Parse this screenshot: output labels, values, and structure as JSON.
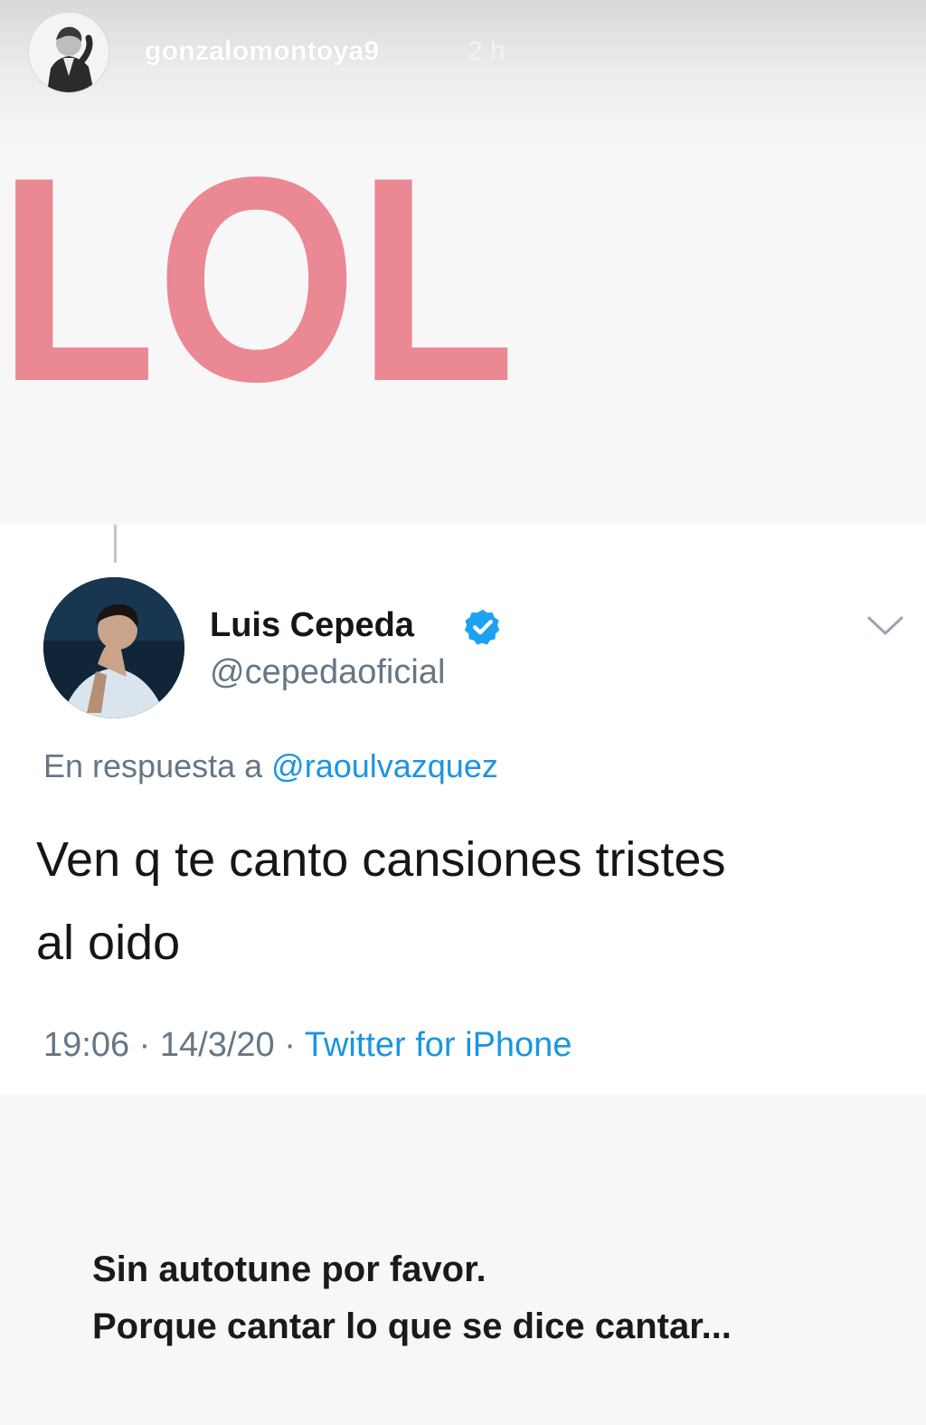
{
  "story": {
    "username": "gonzalomontoya9",
    "time": "2 h",
    "sticker_text": "LOL",
    "sticker_color": "#ea8893"
  },
  "tweet": {
    "display_name": "Luis Cepeda",
    "handle": "@cepedaoficial",
    "verified": true,
    "reply_prefix": "En respuesta a",
    "reply_to": "@raoulvazquez",
    "text_line1": "Ven q te canto cansiones tristes",
    "text_line2": "al oido",
    "time": "19:06",
    "date": "14/3/20",
    "separator": "·",
    "source": "Twitter for iPhone",
    "colors": {
      "link": "#1b95e0",
      "secondary": "#657786",
      "primary": "#14171a"
    },
    "icons": {
      "verified": "verified-badge-icon",
      "more": "chevron-down-icon"
    }
  },
  "caption": {
    "line1": "Sin autotune por favor.",
    "line2": "Porque cantar lo que se dice cantar..."
  }
}
